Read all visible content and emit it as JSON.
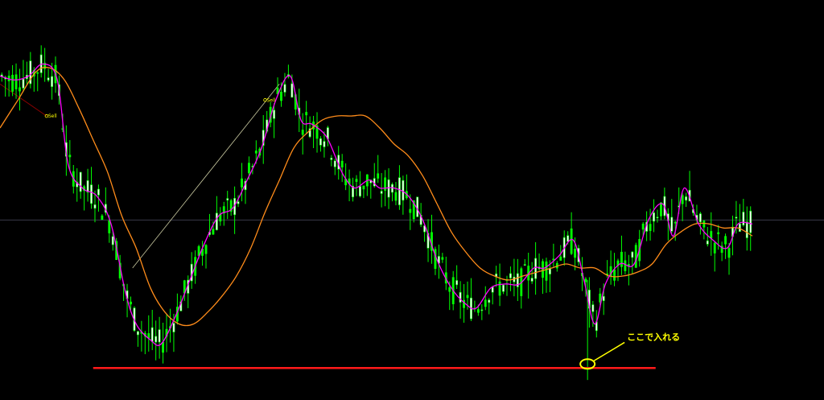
{
  "chart_data": {
    "type": "candlestick",
    "title": "",
    "xlabel": "",
    "ylabel": "",
    "xlim": [
      0,
      230
    ],
    "ylim": [
      0,
      100
    ],
    "grid": false,
    "background": "#000000",
    "colors": {
      "bull": "#ffffff",
      "bear": "#00ff00",
      "wick": "#00ff00",
      "ma_fast": "#ff00ff",
      "ma_slow": "#ff8c1a",
      "support": "#ff1a1a",
      "annotation": "#ffff00",
      "hline": "#3a3a4a",
      "trend": "#c8c8a0",
      "arrow": "#8b0000"
    },
    "ohlc": [],
    "ma_fast": {
      "name": "",
      "points": [
        [
          0,
          81
        ],
        [
          4,
          80
        ],
        [
          8,
          81
        ],
        [
          12,
          84
        ],
        [
          16,
          80
        ],
        [
          19,
          59
        ],
        [
          23,
          53
        ],
        [
          27,
          51
        ],
        [
          31,
          44
        ],
        [
          35,
          27
        ],
        [
          38,
          19
        ],
        [
          42,
          15
        ],
        [
          45,
          14
        ],
        [
          49,
          21
        ],
        [
          53,
          30
        ],
        [
          57,
          39
        ],
        [
          61,
          46
        ],
        [
          65,
          48
        ],
        [
          69,
          55
        ],
        [
          73,
          63
        ],
        [
          77,
          75
        ],
        [
          81,
          81
        ],
        [
          84,
          70
        ],
        [
          87,
          69
        ],
        [
          91,
          66
        ],
        [
          94,
          60
        ],
        [
          96,
          56
        ],
        [
          99,
          53
        ],
        [
          103,
          55
        ],
        [
          106,
          53
        ],
        [
          110,
          53
        ],
        [
          114,
          51
        ],
        [
          118,
          45
        ],
        [
          122,
          35
        ],
        [
          126,
          28
        ],
        [
          130,
          24
        ],
        [
          133,
          23
        ],
        [
          137,
          28
        ],
        [
          141,
          29
        ],
        [
          145,
          29
        ],
        [
          149,
          33
        ],
        [
          152,
          33
        ],
        [
          156,
          36
        ],
        [
          160,
          40
        ],
        [
          163,
          30
        ],
        [
          166,
          19
        ],
        [
          169,
          29
        ],
        [
          173,
          34
        ],
        [
          177,
          34
        ],
        [
          181,
          45
        ],
        [
          185,
          49
        ],
        [
          188,
          41
        ],
        [
          191,
          53
        ],
        [
          195,
          44
        ],
        [
          199,
          40
        ],
        [
          203,
          38
        ],
        [
          206,
          44
        ],
        [
          210,
          44
        ]
      ]
    },
    "ma_slow": {
      "name": "",
      "points": [
        [
          0,
          68
        ],
        [
          5,
          75
        ],
        [
          10,
          82
        ],
        [
          14,
          83
        ],
        [
          18,
          80
        ],
        [
          22,
          73
        ],
        [
          26,
          65
        ],
        [
          30,
          57
        ],
        [
          34,
          46
        ],
        [
          38,
          38
        ],
        [
          42,
          28
        ],
        [
          46,
          22
        ],
        [
          50,
          19
        ],
        [
          54,
          19
        ],
        [
          58,
          22
        ],
        [
          62,
          26
        ],
        [
          66,
          31
        ],
        [
          70,
          38
        ],
        [
          74,
          47
        ],
        [
          78,
          55
        ],
        [
          82,
          63
        ],
        [
          86,
          67
        ],
        [
          90,
          70
        ],
        [
          94,
          71
        ],
        [
          98,
          71
        ],
        [
          102,
          71
        ],
        [
          106,
          68
        ],
        [
          110,
          64
        ],
        [
          114,
          61
        ],
        [
          118,
          56
        ],
        [
          122,
          49
        ],
        [
          126,
          42
        ],
        [
          130,
          37
        ],
        [
          134,
          33
        ],
        [
          138,
          31
        ],
        [
          142,
          30
        ],
        [
          146,
          31
        ],
        [
          150,
          32
        ],
        [
          154,
          33
        ],
        [
          158,
          34
        ],
        [
          162,
          33
        ],
        [
          166,
          33
        ],
        [
          170,
          31
        ],
        [
          174,
          31
        ],
        [
          178,
          32
        ],
        [
          182,
          34
        ],
        [
          186,
          39
        ],
        [
          190,
          42
        ],
        [
          194,
          44
        ],
        [
          198,
          44
        ],
        [
          202,
          43
        ],
        [
          206,
          43
        ],
        [
          210,
          41
        ]
      ]
    },
    "horizontal_line": 45,
    "support_line": {
      "value": 8,
      "x_range": [
        26,
        183
      ]
    },
    "trend_line": [
      [
        37,
        33
      ],
      [
        78,
        79
      ]
    ],
    "target_marker": {
      "x": 164,
      "y": 9
    },
    "sell_marker": {
      "x": 13,
      "y": 71
    },
    "annotations": [
      {
        "text": "ここで入れる",
        "x": 175,
        "y": 15
      }
    ],
    "markers": [
      {
        "text": "Sell",
        "x": 13,
        "y": 71
      },
      {
        "text": "Sell",
        "x": 74,
        "y": 75
      }
    ]
  }
}
